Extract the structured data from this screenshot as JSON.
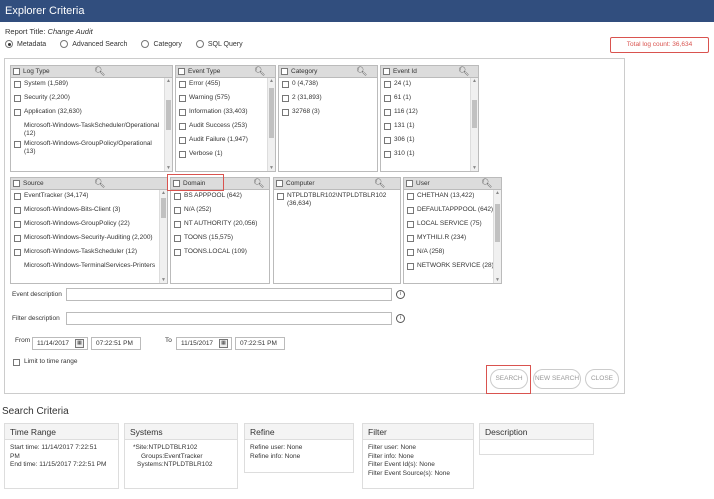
{
  "window": {
    "title": "Explorer Criteria"
  },
  "report": {
    "label": "Report Title:",
    "value": "Change Audit"
  },
  "modes": [
    {
      "label": "Metadata",
      "selected": true
    },
    {
      "label": "Advanced Search",
      "selected": false
    },
    {
      "label": "Category",
      "selected": false
    },
    {
      "label": "SQL Query",
      "selected": false
    }
  ],
  "log_count": "Total log count: 36,634",
  "lists": {
    "log_type": {
      "header": "Log Type",
      "items": [
        "System (1,589)",
        "Security (2,200)",
        "Application (32,630)",
        "Microsoft-Windows-TaskScheduler/Operational (12)",
        "Microsoft-Windows-GroupPolicy/Operational (13)"
      ]
    },
    "event_type": {
      "header": "Event Type",
      "items": [
        "Error (455)",
        "Warning (575)",
        "Information (33,403)",
        "Audit Success (253)",
        "Audit Failure (1,947)",
        "Verbose (1)"
      ]
    },
    "category": {
      "header": "Category",
      "items": [
        "0 (4,738)",
        "2 (31,893)",
        "32768 (3)"
      ]
    },
    "event_id": {
      "header": "Event Id",
      "items": [
        "24 (1)",
        "61 (1)",
        "116 (12)",
        "131 (1)",
        "306 (1)",
        "310 (1)"
      ]
    },
    "source": {
      "header": "Source",
      "items": [
        "EventTracker (34,174)",
        "Microsoft-Windows-Bits-Client (3)",
        "Microsoft-Windows-GroupPolicy (22)",
        "Microsoft-Windows-Security-Auditing (2,200)",
        "Microsoft-Windows-TaskScheduler (12)",
        "Microsoft-Windows-TerminalServices-Printers"
      ]
    },
    "domain": {
      "header": "Domain",
      "items": [
        "BS APPPOOL (642)",
        "N/A (252)",
        "NT AUTHORITY (20,056)",
        "TOONS (15,575)",
        "TOONS.LOCAL (109)"
      ]
    },
    "computer": {
      "header": "Computer",
      "items": [
        "NTPLDTBLR102\\NTPLDTBLR102 (36,634)"
      ]
    },
    "user": {
      "header": "User",
      "items": [
        "CHETHAN (13,422)",
        "DEFAULTAPPPOOL (642)",
        "LOCAL SERVICE (75)",
        "MYTHILI.R (234)",
        "N/A (258)",
        "NETWORK SERVICE (28)"
      ]
    }
  },
  "filters": {
    "event_description_label": "Event description",
    "filter_description_label": "Filter description",
    "from_label": "From",
    "to_label": "To",
    "from_date": "11/14/2017",
    "from_time": "07:22:51 PM",
    "to_date": "11/15/2017",
    "to_time": "07:22:51 PM",
    "limit_label": "Limit to time range"
  },
  "buttons": {
    "search": "SEARCH",
    "new_search": "NEW SEARCH",
    "close": "CLOSE"
  },
  "search_criteria": {
    "title": "Search Criteria",
    "time_range": {
      "header": "Time Range",
      "lines": [
        "Start time: 11/14/2017 7:22:51",
        "PM",
        "End time: 11/15/2017 7:22:51 PM"
      ]
    },
    "systems": {
      "header": "Systems",
      "lines": [
        "*Site:NTPLDTBLR102",
        "Groups:EventTracker",
        "Systems:NTPLDTBLR102"
      ]
    },
    "refine": {
      "header": "Refine",
      "lines": [
        "Refine user: None",
        "Refine info: None"
      ]
    },
    "filter": {
      "header": "Filter",
      "lines": [
        "Filter user: None",
        "Filter info: None",
        "Filter Event Id(s): None",
        "Filter Event Source(s): None"
      ]
    },
    "description": {
      "header": "Description",
      "lines": []
    }
  },
  "colors": {
    "titlebar": "#314e7e",
    "alert_red": "#d9534f"
  },
  "icons": [
    "search-icon",
    "info-icon",
    "calendar-icon"
  ]
}
